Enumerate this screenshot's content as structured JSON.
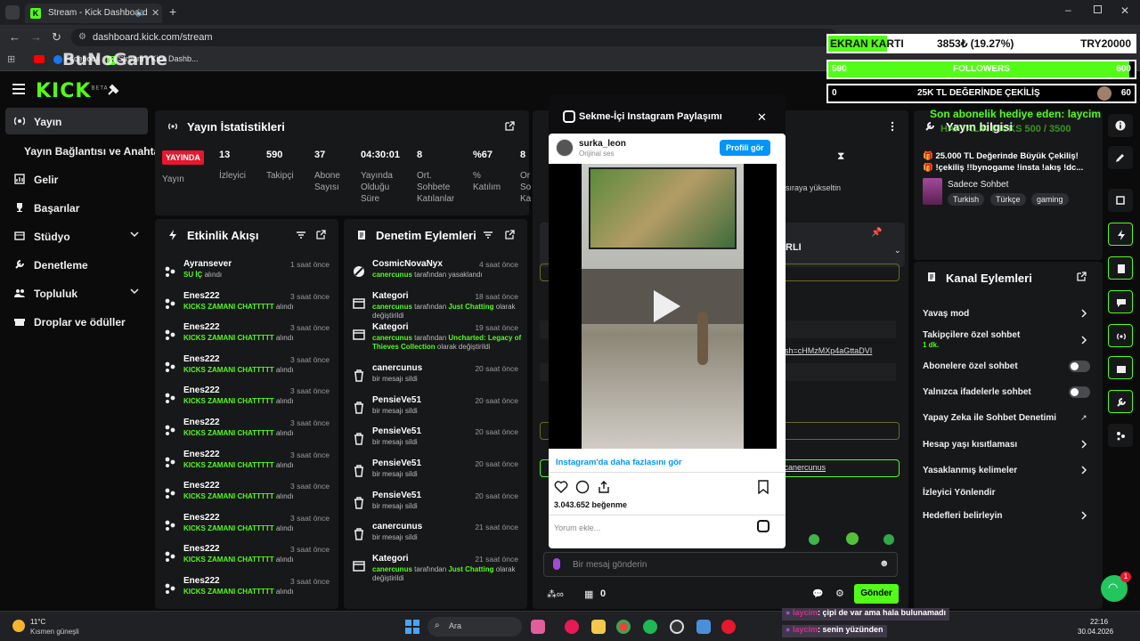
{
  "browser": {
    "tab_title": "Stream - Kick Dashboard",
    "url": "dashboard.kick.com/stream",
    "bookmarks": [
      "Facebook",
      "Stream - Kick Dashb..."
    ],
    "bookmark_folder": "Tüm Yer İşaretleri",
    "watermark": "BuNoGame"
  },
  "stream_overlay": {
    "gpu_label": "EKRAN KARTI",
    "gpu_progress": "3853₺ (19.27%)",
    "gpu_target": "TRY20000",
    "followers_current": "590",
    "followers_label": "FOLLOWERS",
    "followers_goal": "600",
    "followers_progress_pct": 98.3,
    "giveaway_current": "0",
    "giveaway_label": "25K TL DEĞERİNDE ÇEKİLİŞ",
    "giveaway_goal": "60",
    "last_gift_text": "Son abonelik hediye eden: laycim",
    "kicks_text": "HAFTALIK KICKS 500 / 3500"
  },
  "sidebar": {
    "items": [
      {
        "label": "Yayın",
        "active": true
      },
      {
        "label": "Yayın Bağlantısı ve Anahtarı"
      },
      {
        "label": "Gelir"
      },
      {
        "label": "Başarılar"
      },
      {
        "label": "Stüdyo"
      },
      {
        "label": "Denetleme"
      },
      {
        "label": "Topluluk"
      },
      {
        "label": "Droplar ve ödüller"
      }
    ]
  },
  "stats": {
    "title": "Yayın İstatistikleri",
    "live_badge": "YAYINDA",
    "live_label": "Yayın",
    "items": [
      {
        "value": "13",
        "label": "İzleyici"
      },
      {
        "value": "590",
        "label": "Takipçi"
      },
      {
        "value": "37",
        "label": "Abone Sayısı"
      },
      {
        "value": "04:30:01",
        "label": "Yayında Olduğu Süre"
      },
      {
        "value": "8",
        "label": "Ort. Sohbete Katılanlar"
      },
      {
        "value": "%67",
        "label": "% Katılım"
      },
      {
        "value": "8",
        "label": "Or So Ka"
      }
    ]
  },
  "activity": {
    "title": "Etkinlik Akışı",
    "items": [
      {
        "user": "Ayransever",
        "time": "1 saat önce",
        "reward": "SU İÇ",
        "suffix": "alındı"
      },
      {
        "user": "Enes222",
        "time": "3 saat önce",
        "reward": "KICKS ZAMANI CHATTTTT",
        "suffix": "alındı"
      },
      {
        "user": "Enes222",
        "time": "3 saat önce",
        "reward": "KICKS ZAMANI CHATTTTT",
        "suffix": "alındı"
      },
      {
        "user": "Enes222",
        "time": "3 saat önce",
        "reward": "KICKS ZAMANI CHATTTTT",
        "suffix": "alındı"
      },
      {
        "user": "Enes222",
        "time": "3 saat önce",
        "reward": "KICKS ZAMANI CHATTTTT",
        "suffix": "alındı"
      },
      {
        "user": "Enes222",
        "time": "3 saat önce",
        "reward": "KICKS ZAMANI CHATTTTT",
        "suffix": "alındı"
      },
      {
        "user": "Enes222",
        "time": "3 saat önce",
        "reward": "KICKS ZAMANI CHATTTTT",
        "suffix": "alındı"
      },
      {
        "user": "Enes222",
        "time": "3 saat önce",
        "reward": "KICKS ZAMANI CHATTTTT",
        "suffix": "alındı"
      },
      {
        "user": "Enes222",
        "time": "3 saat önce",
        "reward": "KICKS ZAMANI CHATTTTT",
        "suffix": "alındı"
      },
      {
        "user": "Enes222",
        "time": "3 saat önce",
        "reward": "KICKS ZAMANI CHATTTTT",
        "suffix": "alındı"
      },
      {
        "user": "Enes222",
        "time": "3 saat önce",
        "reward": "KICKS ZAMANI CHATTTTT",
        "suffix": "alındı"
      }
    ]
  },
  "moderation": {
    "title": "Denetim Eylemleri",
    "items": [
      {
        "title": "CosmicNovaNyx",
        "time": "4 saat önce",
        "actor": "canercunus",
        "desc": "tarafından yasaklandı",
        "extra": ""
      },
      {
        "title": "Kategori",
        "time": "18 saat önce",
        "actor": "canercunus",
        "desc": "tarafından",
        "extra": "Just Chatting",
        "tail": "olarak değiştirildi"
      },
      {
        "title": "Kategori",
        "time": "19 saat önce",
        "actor": "canercunus",
        "desc": "tarafından",
        "extra": "Uncharted: Legacy of Thieves Collection",
        "tail": "olarak değiştirildi"
      },
      {
        "title": "canercunus",
        "time": "20 saat önce",
        "desc": "bir mesajı sildi"
      },
      {
        "title": "PensieVe51",
        "time": "20 saat önce",
        "desc": "bir mesajı sildi"
      },
      {
        "title": "PensieVe51",
        "time": "20 saat önce",
        "desc": "bir mesajı sildi"
      },
      {
        "title": "PensieVe51",
        "time": "20 saat önce",
        "desc": "bir mesajı sildi"
      },
      {
        "title": "PensieVe51",
        "time": "20 saat önce",
        "desc": "bir mesajı sildi"
      },
      {
        "title": "canercunus",
        "time": "21 saat önce",
        "desc": "bir mesajı sildi"
      },
      {
        "title": "Kategori",
        "time": "21 saat önce",
        "actor": "canercunus",
        "desc": "tarafından",
        "extra": "Just Chatting",
        "tail": "olarak değiştirildi"
      }
    ]
  },
  "chat": {
    "queue_text": "sıraya yükseltin",
    "pinned_label": "RLI",
    "link_fragment": "igsh=cHMzMXp4aGttaDVI",
    "link2_fragment": "n/canercunus",
    "input_placeholder": "Bir mesaj gönderin",
    "send_label": "Gönder",
    "counter": "0"
  },
  "modal": {
    "title": "Sekme-İçi Instagram Paylaşımı",
    "username": "surka_leon",
    "audio": "Orijinal ses",
    "profile_button": "Profili gör",
    "more_link": "Instagram'da daha fazlasını gör",
    "likes": "3.043.652 beğenme",
    "comment_placeholder": "Yorum ekle..."
  },
  "stream_info": {
    "title": "Yayın bilgisi",
    "line1": "🎁 25.000 TL Değerinde Büyük Çekiliş!",
    "line2": "🎁 !çekiliş !!bynogame !insta !akış !dc...",
    "category": "Sadece Sohbet",
    "tags": [
      "Turkish",
      "Türkçe",
      "gaming"
    ]
  },
  "channel_actions": {
    "title": "Kanal Eylemleri",
    "items": [
      {
        "label": "Yavaş mod",
        "control": "chevron"
      },
      {
        "label": "Takipçilere özel sohbet",
        "sub": "1 dk.",
        "control": "chevron"
      },
      {
        "label": "Abonelere özel sohbet",
        "control": "toggle"
      },
      {
        "label": "Yalnızca ifadelerle sohbet",
        "control": "toggle"
      },
      {
        "label": "Yapay Zeka ile Sohbet Denetimi",
        "control": "external"
      },
      {
        "label": "Hesap yaşı kısıtlaması",
        "control": "chevron"
      },
      {
        "label": "Yasaklanmış kelimeler",
        "control": "chevron"
      },
      {
        "label": "İzleyici Yönlendir",
        "control": "none"
      },
      {
        "label": "Hedefleri belirleyin",
        "control": "chevron"
      }
    ]
  },
  "overlay_chat": [
    {
      "user": "laycim",
      "msg": ": çipi de var ama hala bulunamadı"
    },
    {
      "user": "laycim",
      "msg": ": senin yüzünden"
    }
  ],
  "taskbar": {
    "weather_temp": "11°C",
    "weather_desc": "Kısmen güneşli",
    "search_placeholder": "Ara",
    "time": "22:16",
    "date": "30.04.2026",
    "support_badge": "1"
  },
  "colors": {
    "kick_green": "#53fc18",
    "panel": "#17181a",
    "background": "#0b0b0c",
    "live_red": "#e5182f",
    "instagram_blue": "#0095f6"
  }
}
